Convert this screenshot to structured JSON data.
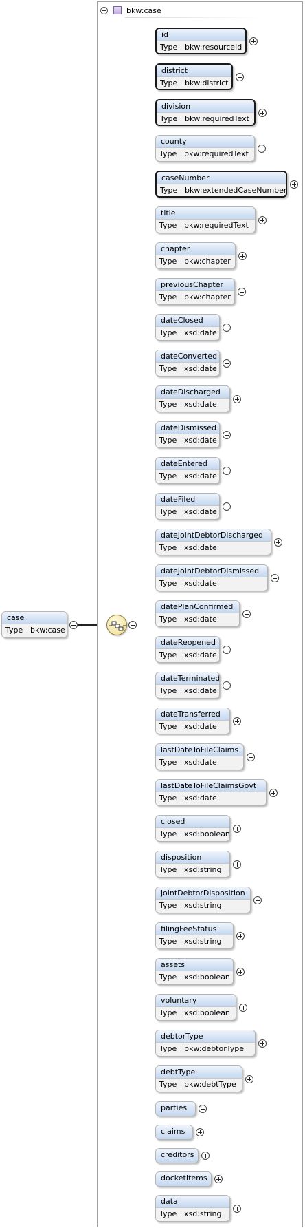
{
  "root": {
    "name": "case",
    "type_label": "Type",
    "type": "bkw:case"
  },
  "frame": {
    "title": "bkw:case"
  },
  "icons": {
    "sequence": "sequence-compositor-icon",
    "expand": "plus-icon",
    "collapse": "minus-icon"
  },
  "elements": [
    {
      "name": "id",
      "type": "bkw:resourceId",
      "required": true
    },
    {
      "name": "district",
      "type": "bkw:district",
      "required": true
    },
    {
      "name": "division",
      "type": "bkw:requiredText",
      "required": true
    },
    {
      "name": "county",
      "type": "bkw:requiredText",
      "required": false
    },
    {
      "name": "caseNumber",
      "type": "bkw:extendedCaseNumber",
      "required": true
    },
    {
      "name": "title",
      "type": "bkw:requiredText",
      "required": false
    },
    {
      "name": "chapter",
      "type": "bkw:chapter",
      "required": false
    },
    {
      "name": "previousChapter",
      "type": "bkw:chapter",
      "required": false
    },
    {
      "name": "dateClosed",
      "type": "xsd:date",
      "required": false
    },
    {
      "name": "dateConverted",
      "type": "xsd:date",
      "required": false
    },
    {
      "name": "dateDischarged",
      "type": "xsd:date",
      "required": false
    },
    {
      "name": "dateDismissed",
      "type": "xsd:date",
      "required": false
    },
    {
      "name": "dateEntered",
      "type": "xsd:date",
      "required": false
    },
    {
      "name": "dateFiled",
      "type": "xsd:date",
      "required": false
    },
    {
      "name": "dateJointDebtorDischarged",
      "type": "xsd:date",
      "required": false
    },
    {
      "name": "dateJointDebtorDismissed",
      "type": "xsd:date",
      "required": false
    },
    {
      "name": "datePlanConfirmed",
      "type": "xsd:date",
      "required": false
    },
    {
      "name": "dateReopened",
      "type": "xsd:date",
      "required": false
    },
    {
      "name": "dateTerminated",
      "type": "xsd:date",
      "required": false
    },
    {
      "name": "dateTransferred",
      "type": "xsd:date",
      "required": false
    },
    {
      "name": "lastDateToFileClaims",
      "type": "xsd:date",
      "required": false
    },
    {
      "name": "lastDateToFileClaimsGovt",
      "type": "xsd:date",
      "required": false
    },
    {
      "name": "closed",
      "type": "xsd:boolean",
      "required": false
    },
    {
      "name": "disposition",
      "type": "xsd:string",
      "required": false
    },
    {
      "name": "jointDebtorDisposition",
      "type": "xsd:string",
      "required": false
    },
    {
      "name": "filingFeeStatus",
      "type": "xsd:string",
      "required": false
    },
    {
      "name": "assets",
      "type": "xsd:boolean",
      "required": false
    },
    {
      "name": "voluntary",
      "type": "xsd:boolean",
      "required": false
    },
    {
      "name": "debtorType",
      "type": "bkw:debtorType",
      "required": false
    },
    {
      "name": "debtType",
      "type": "bkw:debtType",
      "required": false
    },
    {
      "name": "parties",
      "type": "",
      "required": false
    },
    {
      "name": "claims",
      "type": "",
      "required": false
    },
    {
      "name": "creditors",
      "type": "",
      "required": false
    },
    {
      "name": "docketItems",
      "type": "",
      "required": false
    },
    {
      "name": "data",
      "type": "xsd:string",
      "required": false
    }
  ]
}
